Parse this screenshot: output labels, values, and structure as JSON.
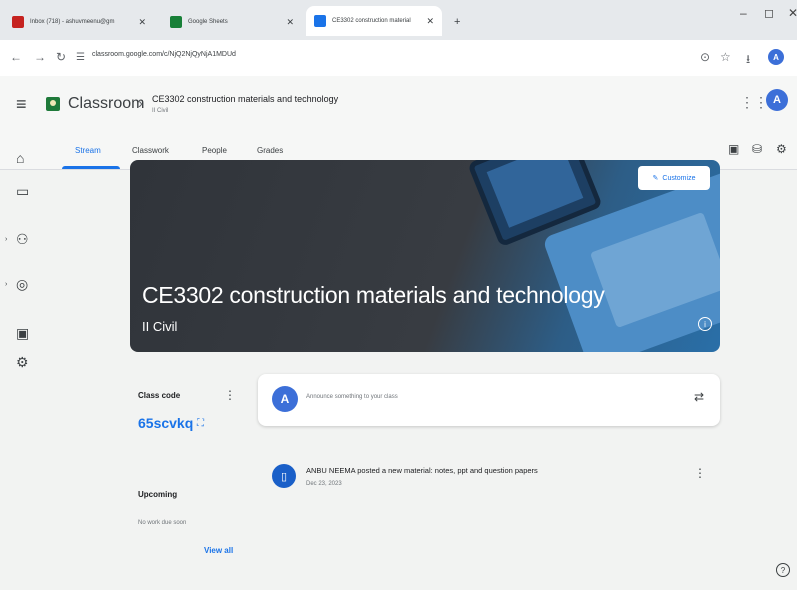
{
  "browser": {
    "tabs": [
      {
        "label": "Inbox (718) - ashuvmeenu@gm",
        "favicon_color": "#c5221f"
      },
      {
        "label": "Google Sheets",
        "favicon_color": "#188038"
      },
      {
        "label": "CE3302 construction material",
        "favicon_color": "#1a73e8"
      }
    ],
    "url": "classroom.google.com/c/NjQ2NjQyNjA1MDUd",
    "profile_initial": "A"
  },
  "header": {
    "app_name": "Classroom",
    "breadcrumb_title": "CE3302 construction materials and technology",
    "breadcrumb_sub": "II Civil",
    "profile_initial": "A"
  },
  "tabs": [
    "Stream",
    "Classwork",
    "People",
    "Grades"
  ],
  "banner": {
    "title": "CE3302 construction materials and technology",
    "subtitle": "II Civil",
    "customize_label": "Customize"
  },
  "class_code": {
    "label": "Class code",
    "value": "65scvkq"
  },
  "upcoming": {
    "label": "Upcoming",
    "empty_text": "No work due soon",
    "view_all_label": "View all"
  },
  "announce": {
    "avatar_initial": "A",
    "placeholder": "Announce something to your class"
  },
  "post": {
    "title": "ANBU NEEMA posted a new material: notes, ppt and question papers",
    "date": "Dec 23, 2023"
  },
  "colors": {
    "accent": "#1a73e8",
    "avatar": "#3c6fd8"
  }
}
